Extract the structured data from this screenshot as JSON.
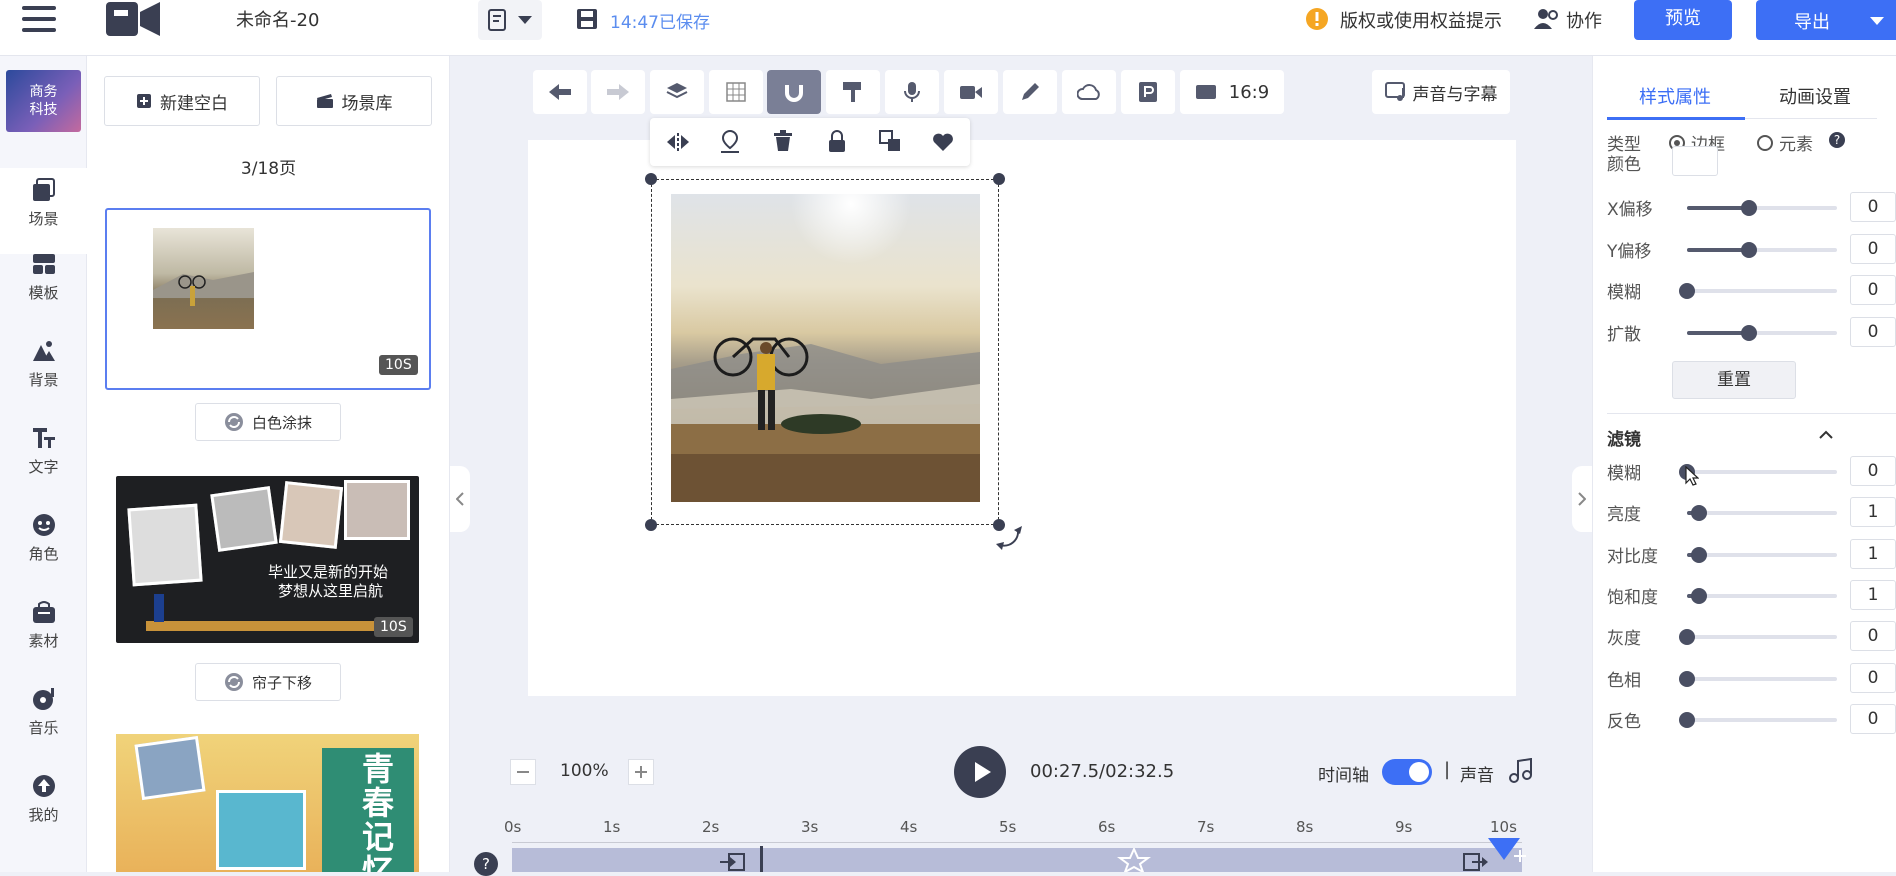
{
  "header": {
    "doc_title": "未命名-20",
    "save_status": "14:47已保存",
    "copyright_hint": "版权或使用权益提示",
    "collab_label": "协作",
    "preview_label": "预览",
    "export_label": "导出"
  },
  "brand": {
    "logo_text": "商务科技"
  },
  "left_nav": {
    "items": [
      {
        "label": "场景",
        "icon": "scene-icon"
      },
      {
        "label": "模板",
        "icon": "template-icon"
      },
      {
        "label": "背景",
        "icon": "background-icon"
      },
      {
        "label": "文字",
        "icon": "text-icon"
      },
      {
        "label": "角色",
        "icon": "character-icon"
      },
      {
        "label": "素材",
        "icon": "material-icon"
      },
      {
        "label": "音乐",
        "icon": "music-icon"
      },
      {
        "label": "我的",
        "icon": "my-icon"
      }
    ]
  },
  "scene_panel": {
    "new_blank_label": "新建空白",
    "scene_library_label": "场景库",
    "page_indicator": "3/18页",
    "scenes": [
      {
        "duration": "10S",
        "transition": "白色涂抹",
        "selected": true
      },
      {
        "duration": "10S",
        "transition": "帘子下移",
        "caption_line1": "毕业又是新的开始",
        "caption_line2": "梦想从这里启航"
      },
      {
        "title_text": "青春记忆"
      }
    ]
  },
  "toolbar": {
    "aspect_ratio": "16:9",
    "voice_subtitle_label": "声音与字幕"
  },
  "playback": {
    "zoom": "100%",
    "time": "00:27.5/02:32.5",
    "timeline_label": "时间轴",
    "timeline_on": true,
    "separator": "|",
    "sound_label": "声音"
  },
  "timeline": {
    "ticks": [
      "0s",
      "1s",
      "2s",
      "3s",
      "4s",
      "5s",
      "6s",
      "7s",
      "8s",
      "9s",
      "10s"
    ],
    "help": "?"
  },
  "right_panel": {
    "tabs": [
      "样式属性",
      "动画设置"
    ],
    "active_tab": 0,
    "type_label": "类型",
    "type_options": [
      "边框",
      "元素"
    ],
    "type_help": "?",
    "color_label": "颜色",
    "reset_label": "重置",
    "shadow": [
      {
        "label": "X偏移",
        "value": "0",
        "level": 0.5
      },
      {
        "label": "Y偏移",
        "value": "0",
        "level": 0.5
      },
      {
        "label": "模糊",
        "value": "0",
        "level": 0
      },
      {
        "label": "扩散",
        "value": "0",
        "level": 0.5
      }
    ],
    "filter_title": "滤镜",
    "filters": [
      {
        "label": "模糊",
        "value": "0",
        "level": 0
      },
      {
        "label": "亮度",
        "value": "1",
        "level": 0.1
      },
      {
        "label": "对比度",
        "value": "1",
        "level": 0.1
      },
      {
        "label": "饱和度",
        "value": "1",
        "level": 0.1
      },
      {
        "label": "灰度",
        "value": "0",
        "level": 0
      },
      {
        "label": "色相",
        "value": "0",
        "level": 0
      },
      {
        "label": "反色",
        "value": "0",
        "level": 0
      }
    ]
  },
  "colors": {
    "accent": "#3d6ff5",
    "warning": "#f5a623",
    "dark_icon": "#3a3f52"
  }
}
